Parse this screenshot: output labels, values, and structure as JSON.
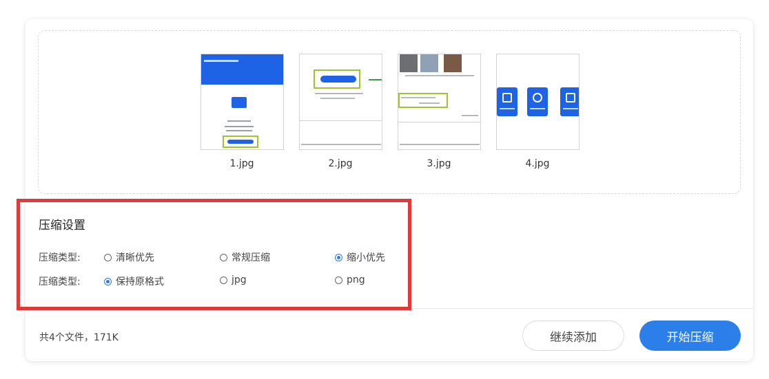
{
  "thumbnails": [
    {
      "name": "1.jpg"
    },
    {
      "name": "2.jpg"
    },
    {
      "name": "3.jpg"
    },
    {
      "name": "4.jpg"
    }
  ],
  "settings": {
    "title": "压缩设置",
    "rows": [
      {
        "label": "压缩类型:",
        "options": [
          {
            "label": "清晰优先",
            "checked": false
          },
          {
            "label": "常规压缩",
            "checked": false
          },
          {
            "label": "缩小优先",
            "checked": true
          }
        ]
      },
      {
        "label": "压缩类型:",
        "options": [
          {
            "label": "保持原格式",
            "checked": true
          },
          {
            "label": "jpg",
            "checked": false
          },
          {
            "label": "png",
            "checked": false
          }
        ]
      }
    ]
  },
  "footer": {
    "info": "共4个文件，171K",
    "continue_label": "继续添加",
    "start_label": "开始压缩"
  },
  "colors": {
    "accent": "#2c7ee8",
    "highlight": "#e0393a",
    "thumb_border_green": "#9cc42c"
  }
}
